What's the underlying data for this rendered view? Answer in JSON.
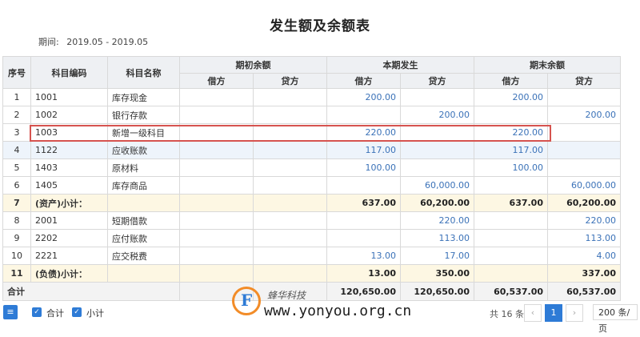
{
  "report": {
    "title": "发生额及余额表",
    "period_label": "期间:",
    "period_value": "2019.05 - 2019.05"
  },
  "table": {
    "headers": {
      "seq": "序号",
      "code": "科目编码",
      "name": "科目名称",
      "opening": "期初余额",
      "current": "本期发生",
      "closing": "期末余额",
      "debit": "借方",
      "credit": "贷方"
    },
    "rows": [
      {
        "seq": "1",
        "code": "1001",
        "name": "库存现金",
        "od": "",
        "oc": "",
        "cd": "200.00",
        "cc": "",
        "ed": "200.00",
        "ec": "",
        "kind": "normal"
      },
      {
        "seq": "2",
        "code": "1002",
        "name": "银行存款",
        "od": "",
        "oc": "",
        "cd": "",
        "cc": "200.00",
        "ed": "",
        "ec": "200.00",
        "kind": "normal"
      },
      {
        "seq": "3",
        "code": "1003",
        "name": "新增一级科目",
        "od": "",
        "oc": "",
        "cd": "220.00",
        "cc": "",
        "ed": "220.00",
        "ec": "",
        "kind": "normal"
      },
      {
        "seq": "4",
        "code": "1122",
        "name": "应收账款",
        "od": "",
        "oc": "",
        "cd": "117.00",
        "cc": "",
        "ed": "117.00",
        "ec": "",
        "kind": "sel"
      },
      {
        "seq": "5",
        "code": "1403",
        "name": "原材料",
        "od": "",
        "oc": "",
        "cd": "100.00",
        "cc": "",
        "ed": "100.00",
        "ec": "",
        "kind": "normal"
      },
      {
        "seq": "6",
        "code": "1405",
        "name": "库存商品",
        "od": "",
        "oc": "",
        "cd": "",
        "cc": "60,000.00",
        "ed": "",
        "ec": "60,000.00",
        "kind": "normal"
      },
      {
        "seq": "7",
        "code": "(资产)小计：",
        "name": "",
        "od": "",
        "oc": "",
        "cd": "637.00",
        "cc": "60,200.00",
        "ed": "637.00",
        "ec": "60,200.00",
        "kind": "sub"
      },
      {
        "seq": "8",
        "code": "2001",
        "name": "短期借款",
        "od": "",
        "oc": "",
        "cd": "",
        "cc": "220.00",
        "ed": "",
        "ec": "220.00",
        "kind": "normal"
      },
      {
        "seq": "9",
        "code": "2202",
        "name": "应付账款",
        "od": "",
        "oc": "",
        "cd": "",
        "cc": "113.00",
        "ed": "",
        "ec": "113.00",
        "kind": "normal"
      },
      {
        "seq": "10",
        "code": "2221",
        "name": "应交税费",
        "od": "",
        "oc": "",
        "cd": "13.00",
        "cc": "17.00",
        "ed": "",
        "ec": "4.00",
        "kind": "normal"
      },
      {
        "seq": "11",
        "code": "(负债)小计：",
        "name": "",
        "od": "",
        "oc": "",
        "cd": "13.00",
        "cc": "350.00",
        "ed": "",
        "ec": "337.00",
        "kind": "sub"
      }
    ],
    "total": {
      "label": "合计",
      "cd": "120,650.00",
      "cc": "120,650.00",
      "ed": "60,537.00",
      "ec": "60,537.00"
    }
  },
  "footer": {
    "menu_icon": "≡",
    "chk_total": "合计",
    "chk_subtotal": "小计",
    "count": "共 16 条",
    "prev": "‹",
    "page": "1",
    "next": "›",
    "page_size": "200 条/页"
  },
  "watermark": {
    "logo_letter": "F",
    "brand": "蜂华科技",
    "url": "www.yonyou.org.cn"
  },
  "colors": {
    "accent": "#2e7bd6",
    "highlight_border": "#d6534f",
    "number": "#3b72b8"
  }
}
